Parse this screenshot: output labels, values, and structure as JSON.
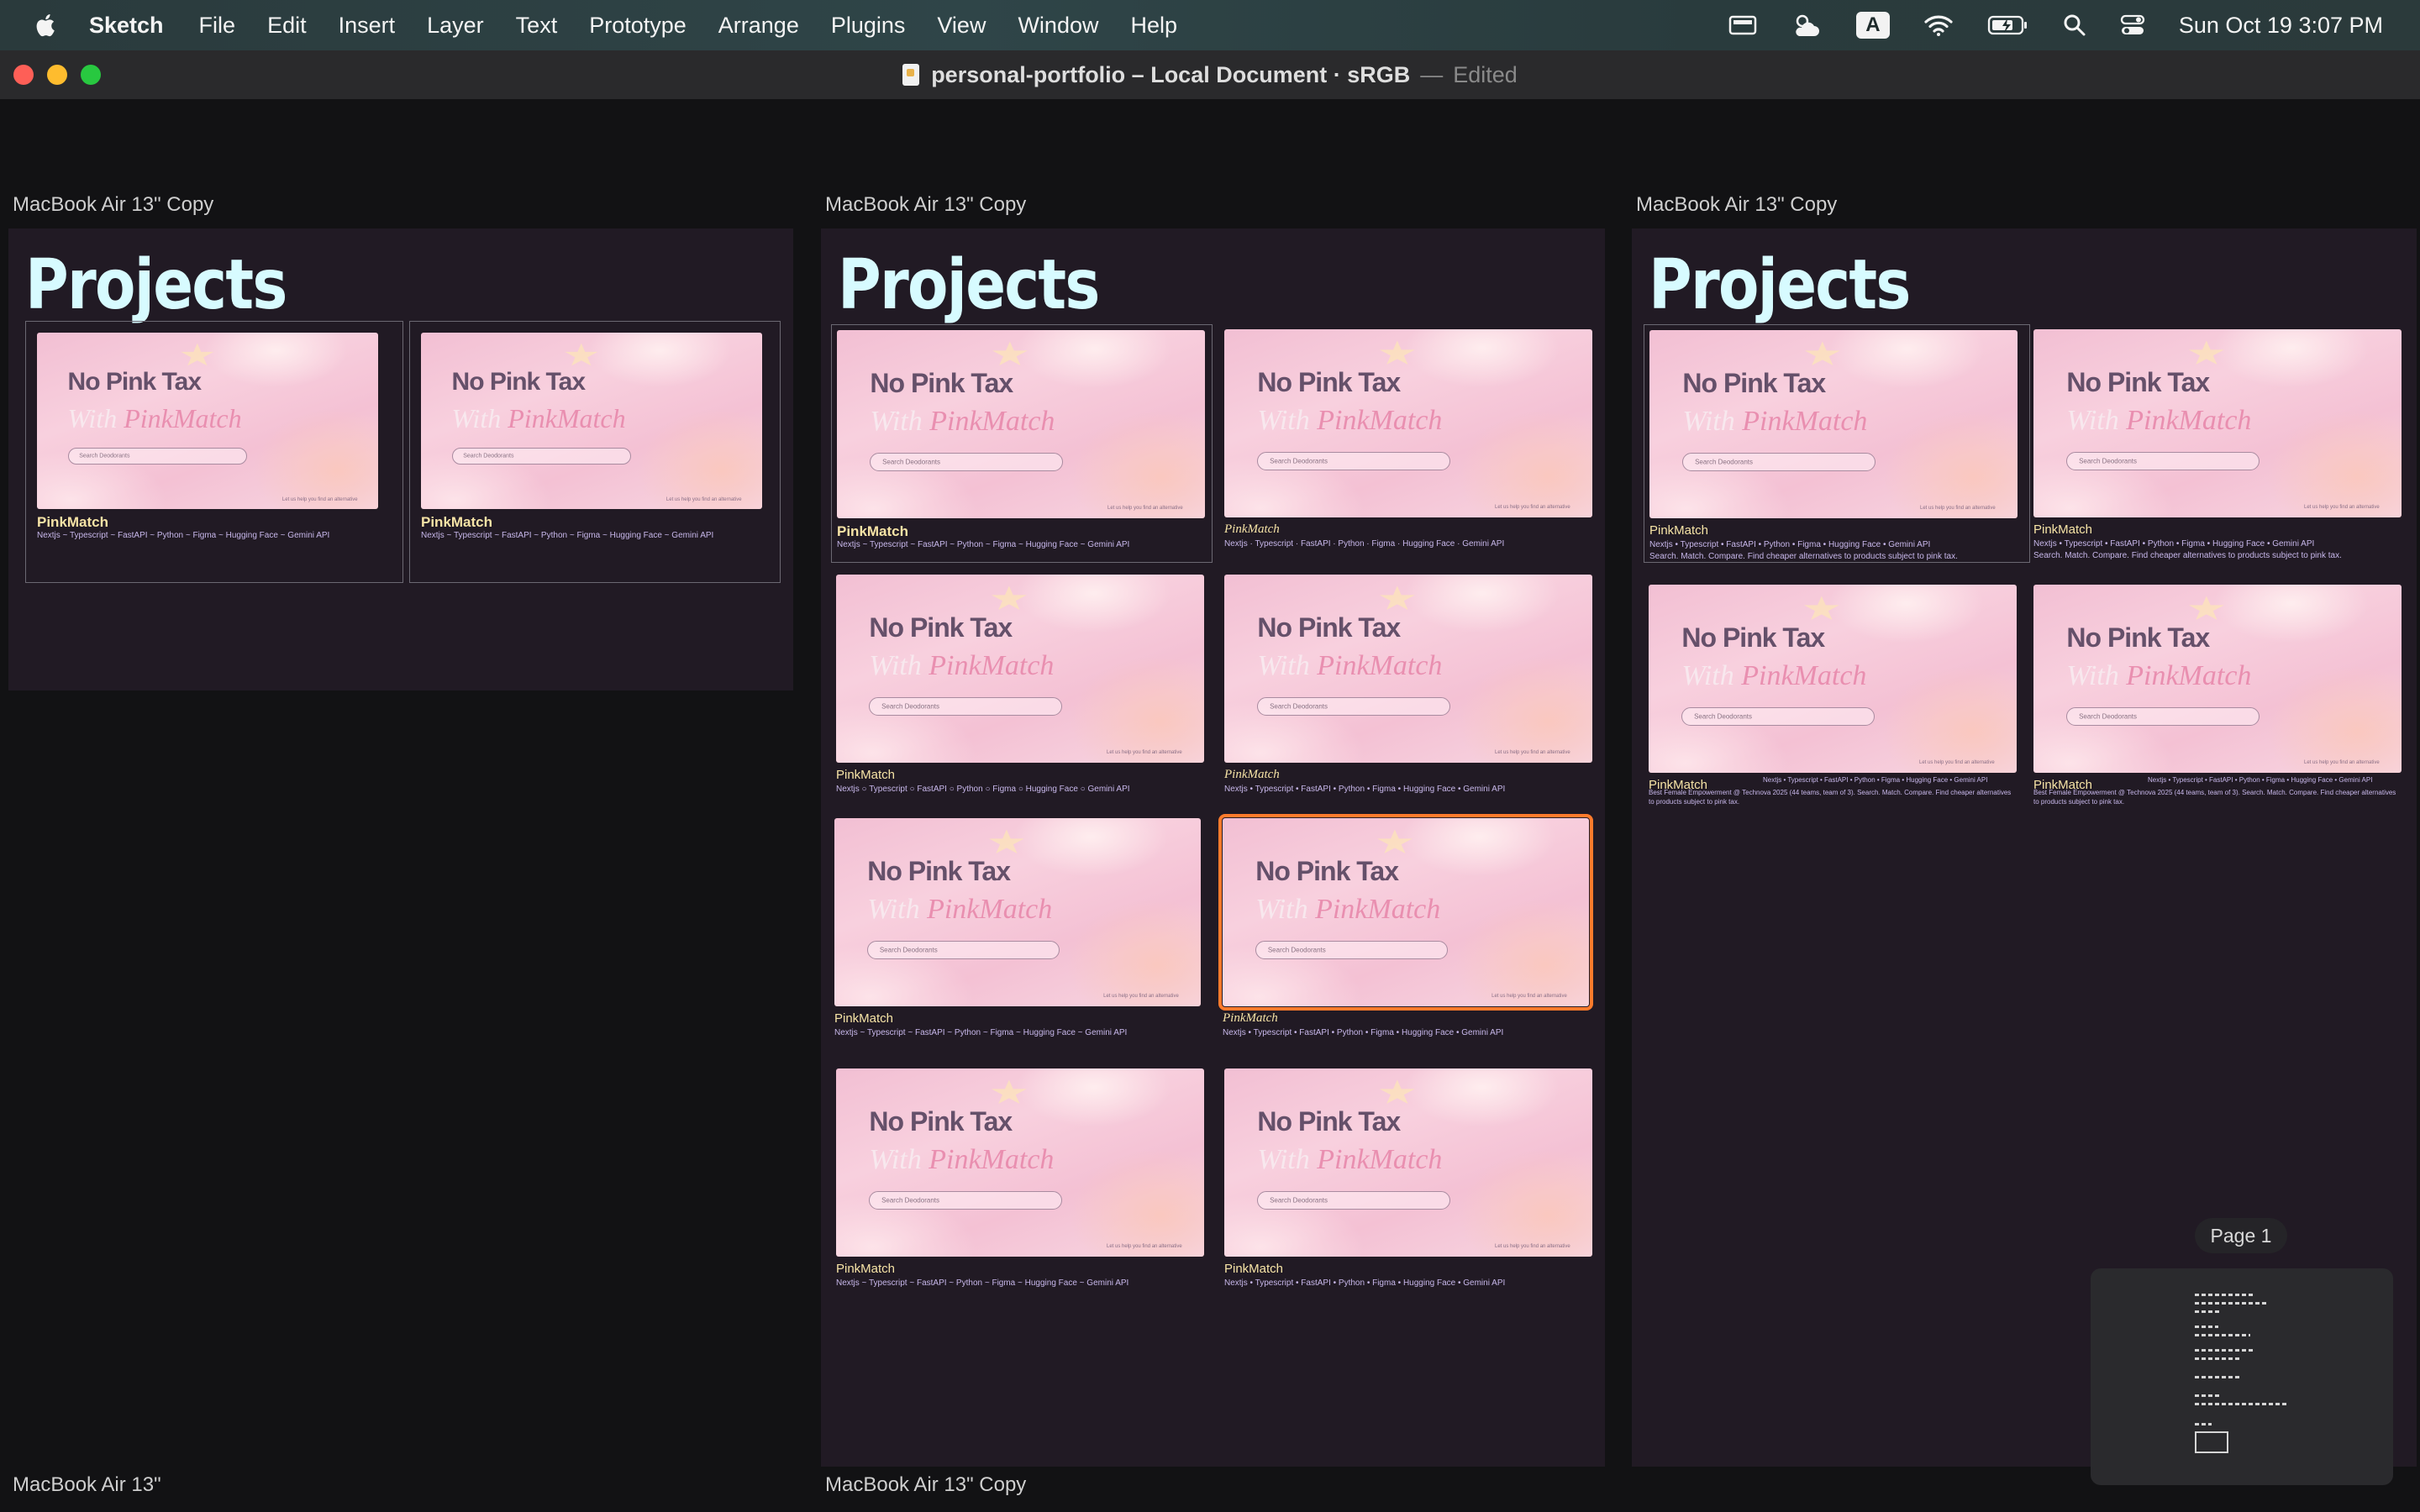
{
  "menubar": {
    "app_name": "Sketch",
    "items": [
      "File",
      "Edit",
      "Insert",
      "Layer",
      "Text",
      "Prototype",
      "Arrange",
      "Plugins",
      "View",
      "Window",
      "Help"
    ],
    "input_source": "A",
    "clock": "Sun Oct 19  3:07 PM"
  },
  "window": {
    "title": "personal-portfolio – Local Document · sRGB",
    "separator": "—",
    "state": "Edited"
  },
  "thumbnail": {
    "headline": "No Pink Tax",
    "subline_with": "With ",
    "subline_brand": "PinkMatch",
    "search_placeholder": "Search Deodorants",
    "footnote": "Let us help you find an alternative"
  },
  "artboards": [
    {
      "label": "MacBook Air 13\" Copy",
      "heading": "Projects",
      "cards": [
        {
          "title": "PinkMatch",
          "tags": "Nextjs ~ Typescript ~ FastAPI ~ Python ~ Figma ~ Hugging Face ~ Gemini API"
        },
        {
          "title": "PinkMatch",
          "tags": "Nextjs ~ Typescript ~ FastAPI ~ Python ~ Figma ~ Hugging Face ~ Gemini API"
        }
      ]
    },
    {
      "label": "MacBook Air 13\" Copy",
      "heading": "Projects",
      "cards": [
        {
          "title": "PinkMatch",
          "tags": "Nextjs ~ Typescript ~ FastAPI ~ Python ~ Figma ~ Hugging Face ~ Gemini API"
        },
        {
          "title": "PinkMatch",
          "tags": "Nextjs · Typescript · FastAPI · Python · Figma · Hugging Face · Gemini API"
        },
        {
          "title": "PinkMatch",
          "tags": "Nextjs ○ Typescript ○ FastAPI ○ Python ○ Figma ○ Hugging Face ○ Gemini API"
        },
        {
          "title": "PinkMatch",
          "tags": "Nextjs  •  Typescript  •  FastAPI  •  Python  •  Figma  •  Hugging Face  •  Gemini API"
        },
        {
          "title": "PinkMatch",
          "tags": "Nextjs ~ Typescript ~ FastAPI ~ Python ~ Figma ~ Hugging Face ~ Gemini API"
        },
        {
          "title": "PinkMatch",
          "tags": "Nextjs • Typescript • FastAPI • Python • Figma • Hugging Face • Gemini API"
        },
        {
          "title": "PinkMatch",
          "tags": "Nextjs ~ Typescript ~ FastAPI ~ Python ~ Figma ~ Hugging Face ~ Gemini API"
        },
        {
          "title": "PinkMatch",
          "tags": "Nextjs • Typescript • FastAPI • Python • Figma • Hugging Face • Gemini API"
        }
      ]
    },
    {
      "label": "MacBook Air 13\" Copy",
      "heading": "Projects",
      "cards": [
        {
          "title": "PinkMatch",
          "tags": "Nextjs • Typescript • FastAPI • Python • Figma • Hugging Face • Gemini API",
          "desc": "Search. Match. Compare. Find cheaper alternatives to products subject to pink tax."
        },
        {
          "title": "PinkMatch",
          "tags": "Nextjs • Typescript • FastAPI • Python • Figma • Hugging Face • Gemini API",
          "desc": "Search. Match. Compare. Find cheaper alternatives to products subject to pink tax."
        },
        {
          "title": "PinkMatch",
          "tags": "Nextjs • Typescript • FastAPI • Python • Figma • Hugging Face • Gemini API",
          "desc": "Best Female Empowerment @ Technova 2025 (44 teams, team of 3). Search. Match. Compare. Find cheaper alternatives to products subject to pink tax."
        },
        {
          "title": "PinkMatch",
          "tags": "Nextjs • Typescript • FastAPI • Python • Figma • Hugging Face • Gemini API",
          "desc": "Best Female Empowerment @ Technova 2025 (44 teams, team of 3). Search. Match. Compare. Find cheaper alternatives to products subject to pink tax."
        }
      ]
    }
  ],
  "bottom_labels": [
    "MacBook Air 13\"",
    "MacBook Air 13\" Copy"
  ],
  "minimap": {
    "page_label": "Page 1"
  },
  "colors": {
    "heading": "#d7fbff",
    "card_title": "#f6e3a6",
    "card_tags": "#c7b7ea",
    "selection": "#ff7b2c",
    "artboard_bg": "#211a24"
  }
}
